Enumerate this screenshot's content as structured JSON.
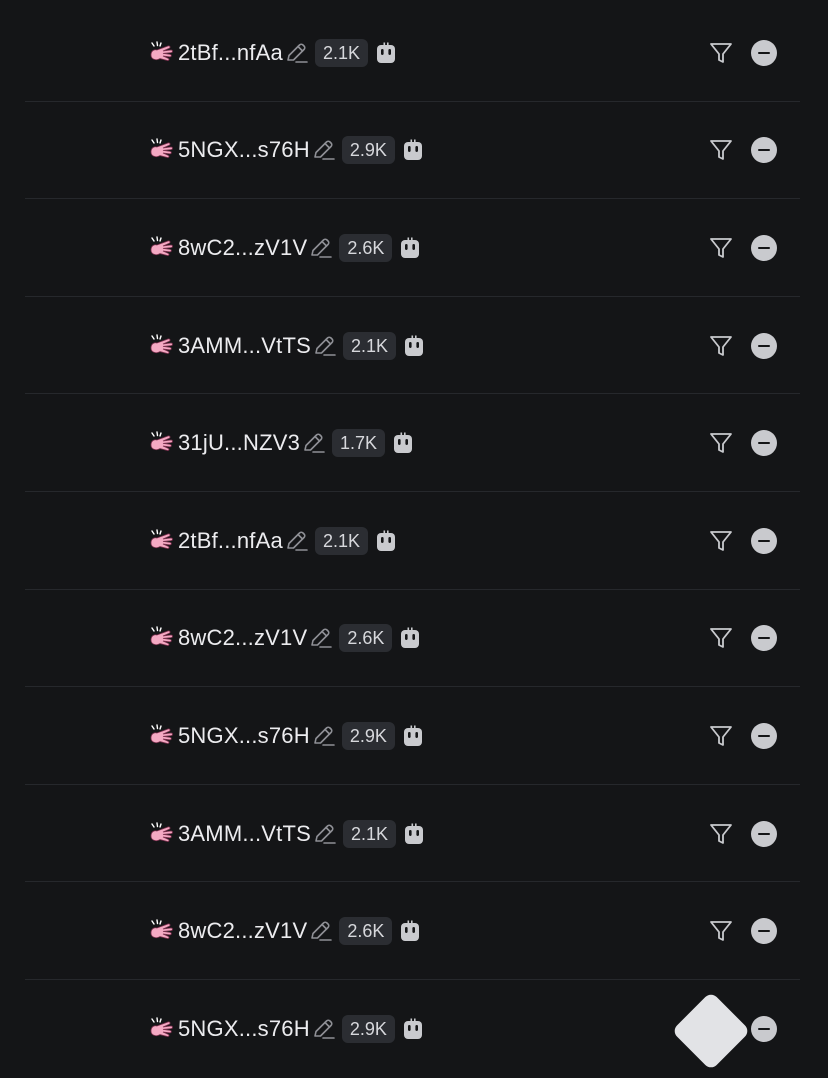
{
  "rows": [
    {
      "address": "2tBf...nfAa",
      "count": "2.1K"
    },
    {
      "address": "5NGX...s76H",
      "count": "2.9K"
    },
    {
      "address": "8wC2...zV1V",
      "count": "2.6K"
    },
    {
      "address": "3AMM...VtTS",
      "count": "2.1K"
    },
    {
      "address": "31jU...NZV3",
      "count": "1.7K"
    },
    {
      "address": "2tBf...nfAa",
      "count": "2.1K"
    },
    {
      "address": "8wC2...zV1V",
      "count": "2.6K"
    },
    {
      "address": "5NGX...s76H",
      "count": "2.9K"
    },
    {
      "address": "3AMM...VtTS",
      "count": "2.1K"
    },
    {
      "address": "8wC2...zV1V",
      "count": "2.6K"
    },
    {
      "address": "5NGX...s76H",
      "count": "2.9K"
    }
  ],
  "icons": {
    "row_leading": "pink-hand-icon",
    "edit": "pencil-icon",
    "bot": "robot-icon",
    "filter": "filter-icon",
    "menu": "menu-circle-icon",
    "scroll_top": "scroll-to-top-icon"
  },
  "colors": {
    "background": "#141517",
    "divider": "#26282c",
    "hand": "#f4a9c3",
    "badge_bg": "#2b2d32",
    "text": "#ececef"
  }
}
